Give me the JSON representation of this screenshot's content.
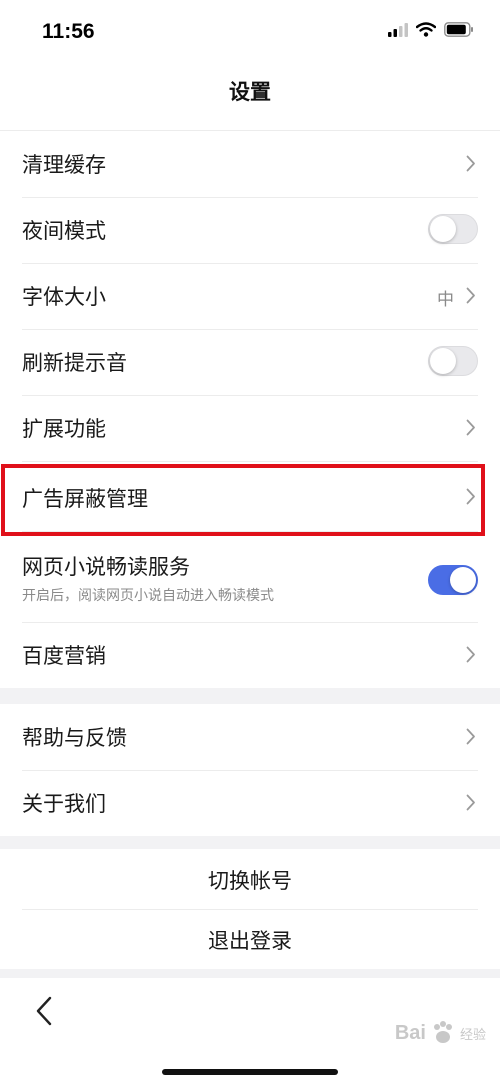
{
  "status": {
    "time": "11:56"
  },
  "nav": {
    "title": "设置"
  },
  "settings": {
    "clear_cache": "清理缓存",
    "night_mode": "夜间模式",
    "font_size": "字体大小",
    "font_size_value": "中",
    "refresh_sound": "刷新提示音",
    "extensions": "扩展功能",
    "ad_block": "广告屏蔽管理",
    "novel_reader": "网页小说畅读服务",
    "novel_reader_desc": "开启后，阅读网页小说自动进入畅读模式",
    "baidu_marketing": "百度营销",
    "help_feedback": "帮助与反馈",
    "about_us": "关于我们"
  },
  "account": {
    "switch": "切换帐号",
    "logout": "退出登录"
  },
  "toggles": {
    "night_mode": false,
    "refresh_sound": false,
    "novel_reader": true
  },
  "watermark": {
    "brand": "Bai",
    "sub": "经验"
  },
  "colors": {
    "accent": "#4a6de5",
    "highlight": "#e0101a",
    "background": "#f2f2f4"
  },
  "icons": [
    "chevron-right-icon",
    "back-arrow-icon",
    "signal-icon",
    "wifi-icon",
    "battery-icon",
    "baidu-paw-icon"
  ]
}
